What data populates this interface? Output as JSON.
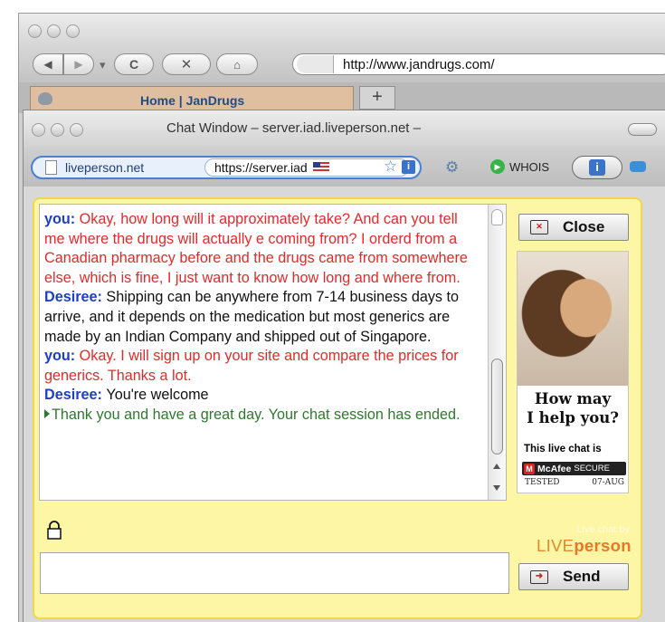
{
  "browser": {
    "address": "http://www.jandrugs.com/",
    "tab": {
      "label": "Home | JanDrugs",
      "new_tab": "+"
    }
  },
  "chat_window": {
    "title": "Chat Window – server.iad.liveperson.net –",
    "site_label": "liveperson.net",
    "address": "https://server.iad",
    "whois_label": "WHOIS"
  },
  "transcript": [
    {
      "speaker": "you: ",
      "text": "Okay, how long will it approximately take? And can you tell me where the drugs will actually e coming from? I orderd from a Canadian pharmacy before and the drugs came from somewhere else, which is fine, I just want to know how long and where from.",
      "style": "you"
    },
    {
      "speaker": "Desiree: ",
      "text": "Shipping can be anywhere from 7-14 business days to arrive, and it depends on the medication but most generics are made by an Indian Company and shipped out of Singapore.",
      "style": "agent"
    },
    {
      "speaker": "you: ",
      "text": "Okay. I will sign up on your site and compare the prices for generics. Thanks a lot.",
      "style": "you"
    },
    {
      "speaker": "Desiree: ",
      "text": "You're welcome",
      "style": "agent"
    },
    {
      "speaker": "",
      "text": "Thank you and have a great day. Your chat session has ended.",
      "style": "system"
    }
  ],
  "buttons": {
    "close": "Close",
    "send": "Send"
  },
  "ad": {
    "headline_1": "How may",
    "headline_2": "I help you?",
    "subtext": "This live chat is",
    "mcafee_name": "McAfee",
    "mcafee_secure": "SECURE",
    "tested": "TESTED",
    "tested_date": "07-AUG"
  },
  "branding": {
    "powered_by": "Live chat by",
    "brand_live": "LIVE",
    "brand_person": "person"
  },
  "input": {
    "value": ""
  },
  "colors": {
    "panel_bg": "#fdf6a5",
    "panel_border": "#efd84a",
    "you_text": "#e32a2a",
    "speaker_name": "#1f3fc3",
    "system_text": "#2c7a2c",
    "tab_bg": "#e0bfa0"
  }
}
